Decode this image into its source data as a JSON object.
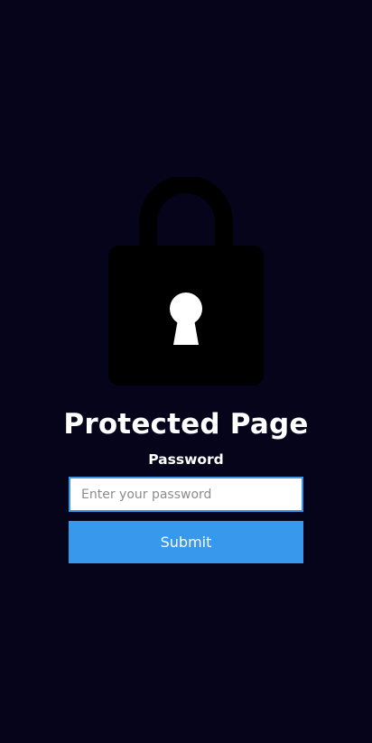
{
  "page": {
    "title": "Protected Page",
    "background_color": "#05041a"
  },
  "lock": {
    "icon": "padlock-icon",
    "body_color": "#000000",
    "keyhole_color": "#ffffff"
  },
  "form": {
    "password_label": "Password",
    "password_placeholder": "Enter your password",
    "password_value": "",
    "submit_label": "Submit",
    "accent_color": "#3898ec"
  }
}
